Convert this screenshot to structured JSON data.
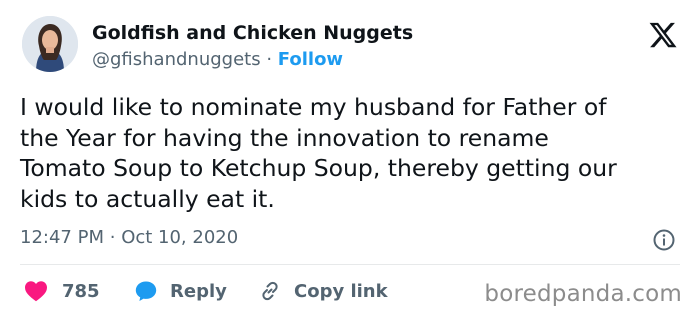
{
  "author": {
    "name": "Goldfish and Chicken Nuggets",
    "handle": "@gfishandnuggets",
    "separator": "·",
    "follow_label": "Follow"
  },
  "tweet": {
    "text": "I would like to nominate my husband for Father of\nthe Year for having the innovation to rename\nTomato Soup to Ketchup Soup, thereby getting our\nkids to actually eat it.",
    "time": "12:47 PM",
    "date_separator": "·",
    "date": "Oct 10, 2020"
  },
  "actions": {
    "like_count": "785",
    "reply_label": "Reply",
    "copy_link_label": "Copy link"
  },
  "watermark": "boredpanda.com",
  "colors": {
    "accent": "#1d9bf0",
    "heart": "#f91880",
    "text": "#0f1419",
    "muted": "#536471"
  },
  "icons": {
    "brand": "x-logo-icon",
    "info": "info-icon",
    "like": "heart-icon",
    "reply": "speech-bubble-icon",
    "copy": "link-icon"
  }
}
